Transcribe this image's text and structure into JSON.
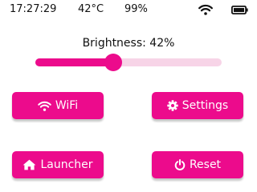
{
  "status_bar": {
    "time": "17:27:29",
    "temperature": "42°C",
    "battery_percent": "99%",
    "icons": [
      "wifi-icon",
      "battery-icon"
    ]
  },
  "brightness": {
    "label": "Brightness: 42%",
    "value": 0.42
  },
  "buttons": {
    "wifi": {
      "label": "WiFi",
      "icon": "wifi-icon"
    },
    "settings": {
      "label": "Settings",
      "icon": "gear-icon"
    },
    "launcher": {
      "label": "Launcher",
      "icon": "home-icon"
    },
    "reset": {
      "label": "Reset",
      "icon": "power-icon"
    }
  },
  "colors": {
    "accent": "#ec0b8c",
    "track": "#f7d4e7",
    "background": "#ffffff",
    "text": "#111111"
  }
}
